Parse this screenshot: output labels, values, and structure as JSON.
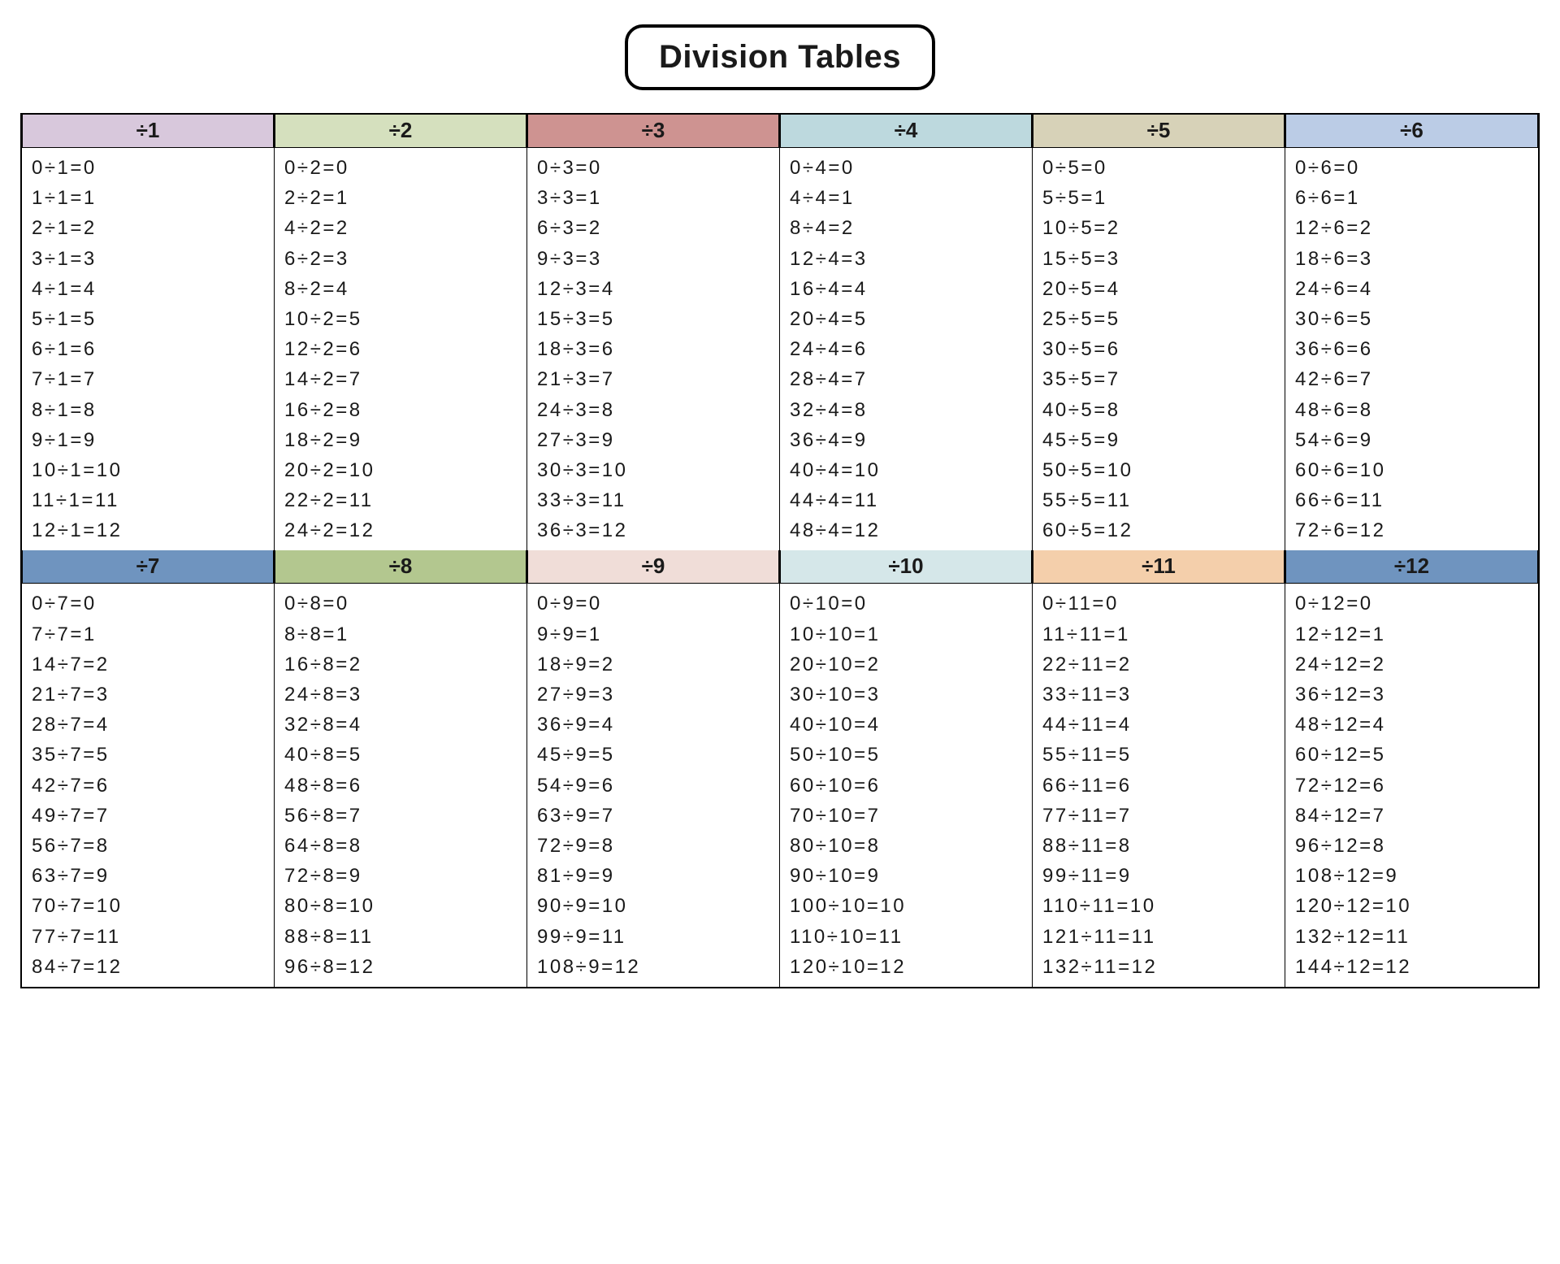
{
  "title": "Division Tables",
  "tables": [
    {
      "divisor": 1,
      "header": "÷1",
      "color": "c1"
    },
    {
      "divisor": 2,
      "header": "÷2",
      "color": "c2"
    },
    {
      "divisor": 3,
      "header": "÷3",
      "color": "c3"
    },
    {
      "divisor": 4,
      "header": "÷4",
      "color": "c4"
    },
    {
      "divisor": 5,
      "header": "÷5",
      "color": "c5"
    },
    {
      "divisor": 6,
      "header": "÷6",
      "color": "c6"
    },
    {
      "divisor": 7,
      "header": "÷7",
      "color": "c7"
    },
    {
      "divisor": 8,
      "header": "÷8",
      "color": "c8"
    },
    {
      "divisor": 9,
      "header": "÷9",
      "color": "c9"
    },
    {
      "divisor": 10,
      "header": "÷10",
      "color": "c10"
    },
    {
      "divisor": 11,
      "header": "÷11",
      "color": "c11"
    },
    {
      "divisor": 12,
      "header": "÷12",
      "color": "c12"
    }
  ],
  "results": [
    0,
    1,
    2,
    3,
    4,
    5,
    6,
    7,
    8,
    9,
    10,
    11,
    12
  ],
  "symbols": {
    "divide": "÷",
    "equals": "="
  }
}
